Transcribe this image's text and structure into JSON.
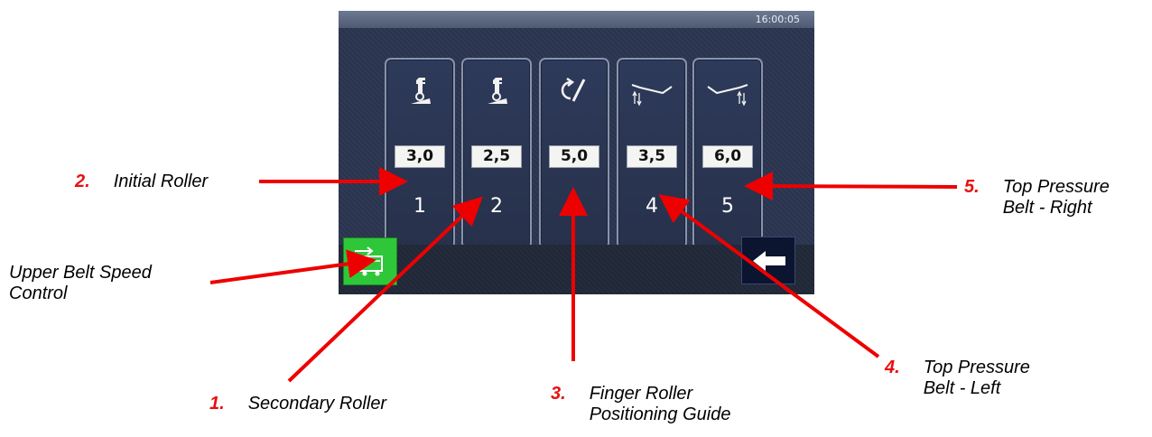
{
  "screen": {
    "clock": "16:00:05",
    "tiles": [
      {
        "icon": "initial-roller-icon",
        "value": "3,0",
        "number": "1"
      },
      {
        "icon": "secondary-roller-icon",
        "value": "2,5",
        "number": "2"
      },
      {
        "icon": "finger-roller-icon",
        "value": "5,0",
        "number": "3"
      },
      {
        "icon": "pressure-belt-left-icon",
        "value": "3,5",
        "number": "4"
      },
      {
        "icon": "pressure-belt-right-icon",
        "value": "6,0",
        "number": "5"
      }
    ],
    "buttons": {
      "belt_speed_icon": "belt-speed-icon",
      "back_icon": "back-arrow-icon"
    },
    "colors": {
      "screen_bg": "#2a3347",
      "tile_border": "#8793ab",
      "green_button": "#2fc73a",
      "back_button": "#0b1530"
    }
  },
  "annotations": [
    {
      "number": "2.",
      "text": "Initial Roller"
    },
    {
      "number": "",
      "text": "Upper Belt Speed\nControl"
    },
    {
      "number": "1.",
      "text": "Secondary Roller"
    },
    {
      "number": "3.",
      "text": "Finger Roller\nPositioning Guide"
    },
    {
      "number": "4.",
      "text": "Top Pressure\nBelt - Left"
    },
    {
      "number": "5.",
      "text": "Top Pressure\nBelt - Right"
    }
  ],
  "annotation_colors": {
    "number": "#e81010",
    "arrow": "#ee0000"
  }
}
